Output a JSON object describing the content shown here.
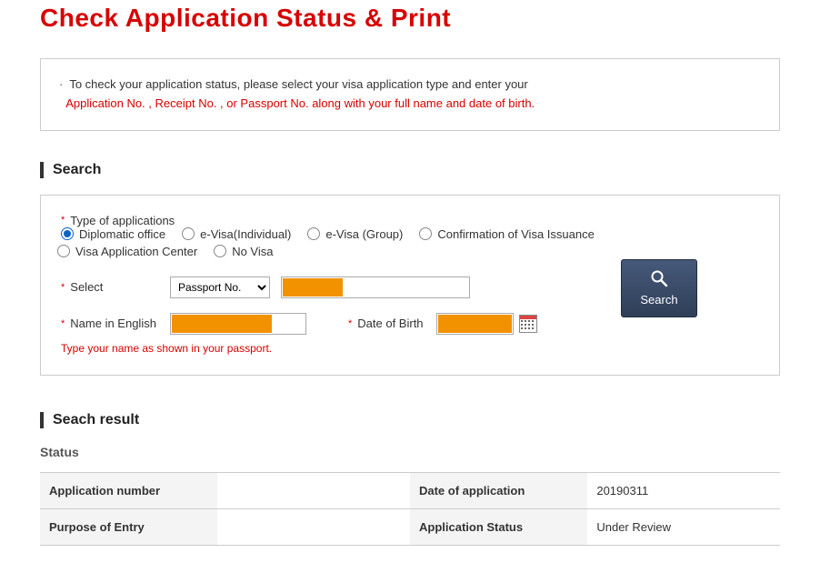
{
  "page": {
    "title": "Check Application Status & Print"
  },
  "notice": {
    "line1": "To check your application status, please select your visa application type and enter your",
    "line2": "Application No. , Receipt No. , or Passport No. along with your full name and date of birth."
  },
  "search": {
    "heading": "Search",
    "type_label": "Type of applications",
    "options": {
      "diplomatic": "Diplomatic office",
      "evisa_individual": "e-Visa(Individual)",
      "evisa_group": "e-Visa (Group)",
      "confirmation": "Confirmation of Visa Issuance",
      "vac": "Visa Application Center",
      "novisa": "No Visa"
    },
    "select_label": "Select",
    "select_value": "Passport No.",
    "name_label": "Name in English",
    "dob_label": "Date of Birth",
    "hint": "Type your name as shown in your passport.",
    "search_button": "Search"
  },
  "result": {
    "heading": "Seach result",
    "status_label": "Status",
    "rows": {
      "app_number_label": "Application number",
      "app_number_value": "",
      "date_label": "Date of application",
      "date_value": "20190311",
      "purpose_label": "Purpose of Entry",
      "purpose_value": "",
      "status_label": "Application Status",
      "status_value": "Under Review"
    }
  }
}
